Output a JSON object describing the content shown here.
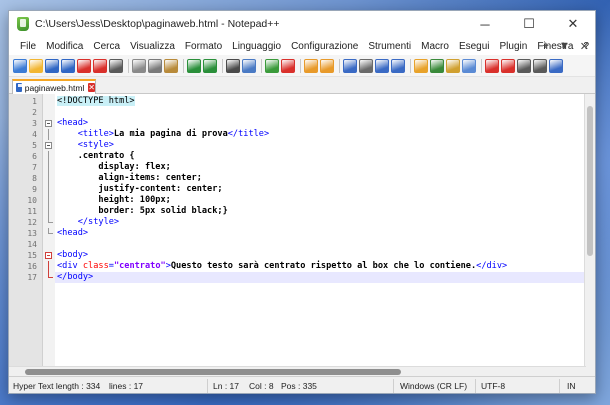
{
  "window": {
    "title": "C:\\Users\\Jess\\Desktop\\paginaweb.html - Notepad++",
    "minimize_glyph": "─",
    "maximize_glyph": "☐",
    "close_glyph": "✕"
  },
  "menu": {
    "items": [
      "File",
      "Modifica",
      "Cerca",
      "Visualizza",
      "Formato",
      "Linguaggio",
      "Configurazione",
      "Strumenti",
      "Macro",
      "Esegui",
      "Plugin",
      "Finestra",
      "?"
    ],
    "right": {
      "plus": "+",
      "dropdown": "▼",
      "close": "✕"
    }
  },
  "toolbar": {
    "icons": [
      "new-file-icon",
      "open-file-icon",
      "save-icon",
      "save-all-icon",
      "close-icon",
      "close-all-icon",
      "print-icon",
      "cut-icon",
      "copy-icon",
      "paste-icon",
      "undo-icon",
      "redo-icon",
      "find-icon",
      "replace-icon",
      "zoom-in-icon",
      "zoom-out-icon",
      "sync-v-icon",
      "sync-h-icon",
      "word-wrap-icon",
      "all-chars-icon",
      "indent-guide-icon",
      "udl-icon",
      "doc-map-icon",
      "function-list-icon",
      "folder-workspace-icon",
      "monitor-icon",
      "record-macro-icon",
      "stop-macro-icon",
      "play-macro-icon",
      "run-macro-icon",
      "save-macro-icon"
    ],
    "colors": [
      "#3a7bd5",
      "#f2b632",
      "#2f66c4",
      "#2f66c4",
      "#d9302b",
      "#d9302b",
      "#5a5a5a",
      "#8a8a8a",
      "#7a7a7a",
      "#b88a3a",
      "#2a8f3a",
      "#2a8f3a",
      "#4a4a4a",
      "#4a7ac4",
      "#3a9a3a",
      "#d9302b",
      "#e89a2a",
      "#e89a2a",
      "#3a6ac4",
      "#6a6a6a",
      "#3a6ac4",
      "#3a6ac4",
      "#e8a22a",
      "#3a8a3a",
      "#d0a030",
      "#5a8ad4",
      "#d9302b",
      "#d9302b",
      "#5a5a5a",
      "#5a5a5a",
      "#3a6ac4"
    ]
  },
  "tab": {
    "label": "paginaweb.html",
    "close_glyph": "✕"
  },
  "editor": {
    "lines": [
      {
        "n": "1",
        "fold": "",
        "parts": [
          [
            "c-doctype",
            "<!DOCTYPE html>"
          ]
        ]
      },
      {
        "n": "2",
        "fold": "",
        "parts": []
      },
      {
        "n": "3",
        "fold": "box",
        "parts": [
          [
            "c-tag",
            "<head>"
          ]
        ]
      },
      {
        "n": "4",
        "fold": "line",
        "parts": [
          [
            "c-text",
            "    "
          ],
          [
            "c-tag",
            "<title>"
          ],
          [
            "c-text",
            "La mia pagina di prova"
          ],
          [
            "c-tag",
            "</title>"
          ]
        ]
      },
      {
        "n": "5",
        "fold": "box",
        "parts": [
          [
            "c-text",
            "    "
          ],
          [
            "c-tag",
            "<style>"
          ]
        ]
      },
      {
        "n": "6",
        "fold": "line",
        "parts": [
          [
            "c-text",
            "    .centrato {"
          ]
        ]
      },
      {
        "n": "7",
        "fold": "line",
        "parts": [
          [
            "c-text",
            "        display: flex;"
          ]
        ]
      },
      {
        "n": "8",
        "fold": "line",
        "parts": [
          [
            "c-text",
            "        align-items: center;"
          ]
        ]
      },
      {
        "n": "9",
        "fold": "line",
        "parts": [
          [
            "c-text",
            "        justify-content: center;"
          ]
        ]
      },
      {
        "n": "10",
        "fold": "line",
        "parts": [
          [
            "c-text",
            "        height: 100px;"
          ]
        ]
      },
      {
        "n": "11",
        "fold": "line",
        "parts": [
          [
            "c-text",
            "        border: 5px solid black;}"
          ]
        ]
      },
      {
        "n": "12",
        "fold": "end",
        "parts": [
          [
            "c-text",
            "    "
          ],
          [
            "c-tag",
            "</style>"
          ]
        ]
      },
      {
        "n": "13",
        "fold": "end",
        "parts": [
          [
            "c-tag",
            "<head>"
          ]
        ]
      },
      {
        "n": "14",
        "fold": "",
        "parts": []
      },
      {
        "n": "15",
        "fold": "box-red",
        "parts": [
          [
            "c-tag",
            "<body>"
          ]
        ]
      },
      {
        "n": "16",
        "fold": "line-red",
        "parts": [
          [
            "c-tag",
            "<div "
          ],
          [
            "c-attr",
            "class"
          ],
          [
            "c-tag",
            "="
          ],
          [
            "c-val",
            "\"centrato\""
          ],
          [
            "c-tag",
            ">"
          ],
          [
            "c-text",
            "Questo testo sarà centrato rispetto al box che lo contiene."
          ],
          [
            "c-tag",
            "</div>"
          ]
        ]
      },
      {
        "n": "17",
        "fold": "end-red",
        "parts": [
          [
            "c-tag",
            "</body>"
          ]
        ],
        "current": true
      }
    ]
  },
  "status": {
    "type": "Hyper Text length : 334",
    "lines": "lines : 17",
    "ln": "Ln : 17",
    "col": "Col : 8",
    "pos": "Pos : 335",
    "eol": "Windows (CR LF)",
    "encoding": "UTF-8",
    "mode": "IN"
  }
}
